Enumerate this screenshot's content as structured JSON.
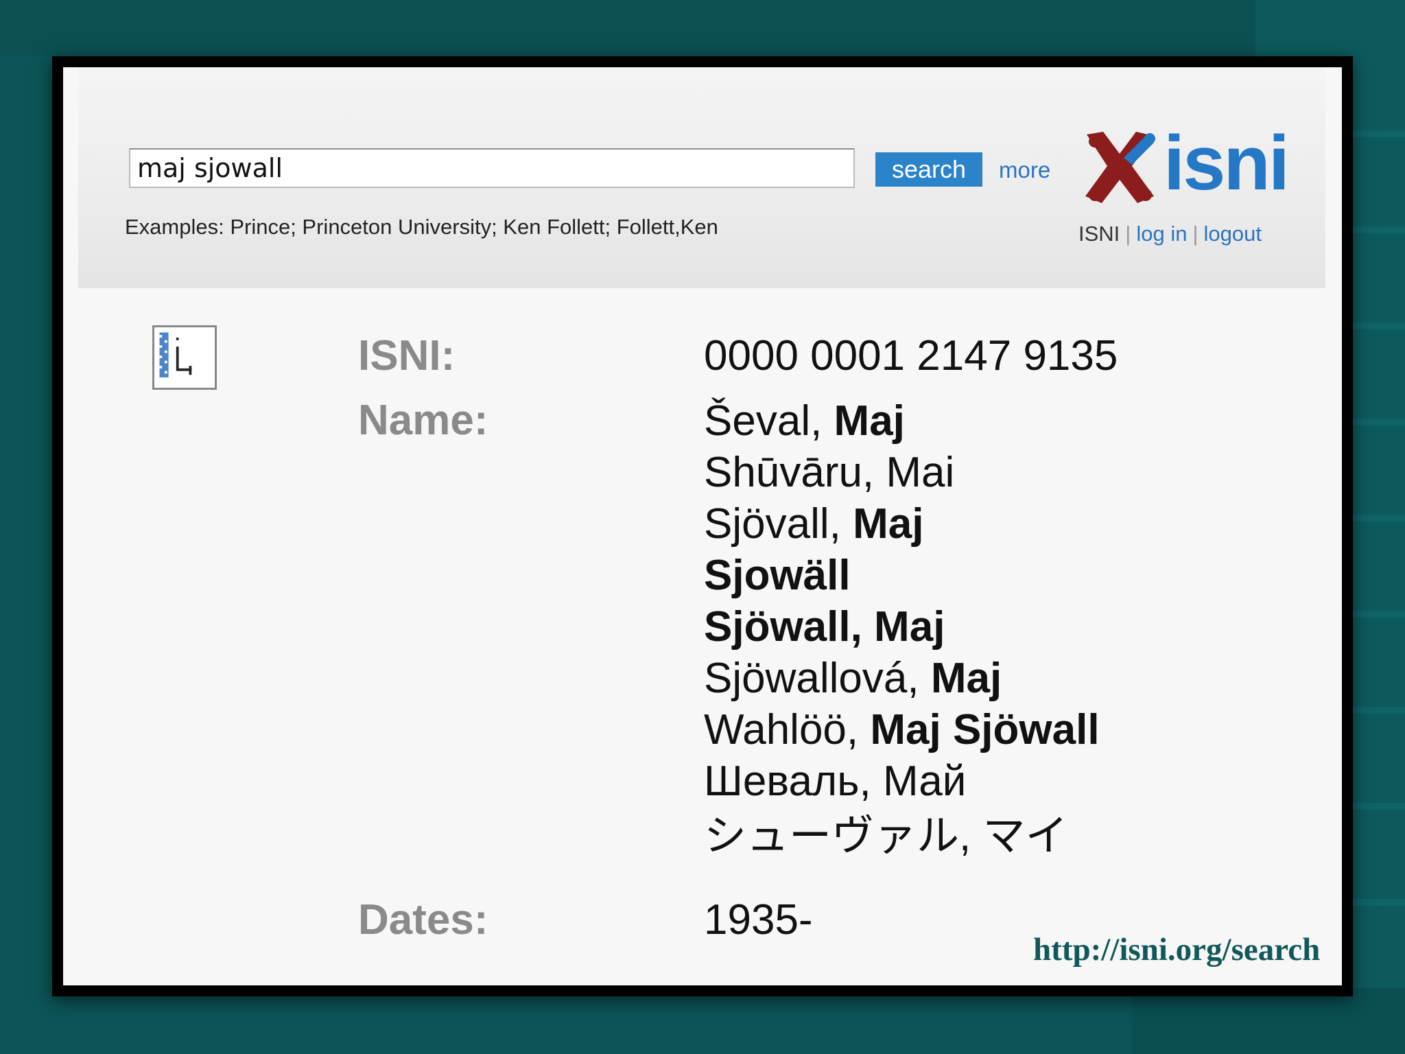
{
  "search": {
    "query": "maj sjowall",
    "button_label": "search",
    "more_label": "more",
    "examples": "Examples: Prince; Princeton University; Ken Follett; Follett,Ken"
  },
  "logo": {
    "text": "isni",
    "colors": {
      "mark": "#8c1d1d",
      "accent": "#2478c6"
    }
  },
  "header_links": {
    "isni": "ISNI",
    "login": "log in",
    "logout": "logout"
  },
  "record": {
    "icon": "document-icon",
    "isni_label": "ISNI:",
    "isni_value": "0000 0001 2147 9135",
    "name_label": "Name:",
    "names": [
      {
        "plain": "Ševal, ",
        "bold": "Maj"
      },
      {
        "plain": "Shūvāru, Mai",
        "bold": ""
      },
      {
        "plain": "Sjövall, ",
        "bold": "Maj"
      },
      {
        "plain": "",
        "bold": "Sjowäll"
      },
      {
        "plain": "",
        "bold": "Sjöwall, Maj"
      },
      {
        "plain": "Sjöwallová, ",
        "bold": "Maj"
      },
      {
        "plain": "Wahlöö, ",
        "bold": "Maj Sjöwall"
      },
      {
        "plain": "Шеваль, Май",
        "bold": ""
      },
      {
        "plain": "シューヴァル, マイ",
        "bold": ""
      }
    ],
    "dates_label": "Dates:",
    "dates_value": "1935-"
  },
  "footer_url": "http://isni.org/search",
  "colors": {
    "background": "#0c5457",
    "link": "#2b73c1",
    "button": "#2b83c9",
    "label_gray": "#8a8a8a"
  }
}
